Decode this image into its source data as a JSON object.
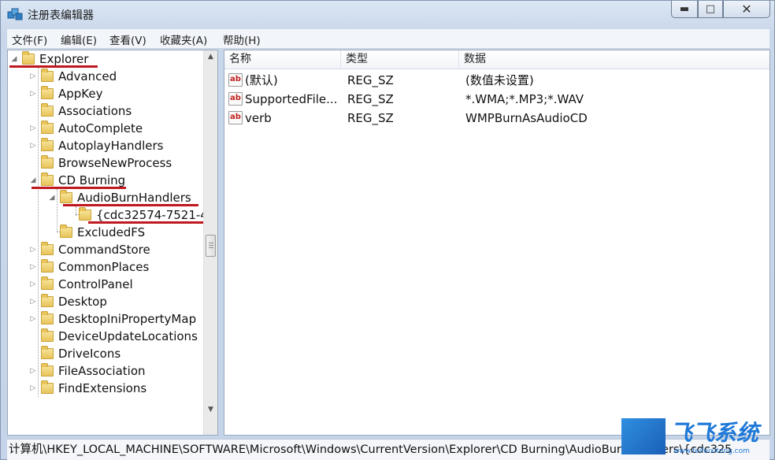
{
  "window": {
    "title": "注册表编辑器"
  },
  "menubar": {
    "items": [
      "文件(F)",
      "编辑(E)",
      "查看(V)",
      "收藏夹(A)",
      "帮助(H)"
    ]
  },
  "tree": {
    "items": [
      {
        "label": "Explorer",
        "level": 0,
        "expander": "open",
        "highlight": true
      },
      {
        "label": "Advanced",
        "level": 1,
        "expander": "closed"
      },
      {
        "label": "AppKey",
        "level": 1,
        "expander": "closed"
      },
      {
        "label": "Associations",
        "level": 1,
        "expander": "none"
      },
      {
        "label": "AutoComplete",
        "level": 1,
        "expander": "closed"
      },
      {
        "label": "AutoplayHandlers",
        "level": 1,
        "expander": "closed"
      },
      {
        "label": "BrowseNewProcess",
        "level": 1,
        "expander": "none"
      },
      {
        "label": "CD Burning",
        "level": 1,
        "expander": "open",
        "highlight": true
      },
      {
        "label": "AudioBurnHandlers",
        "level": 2,
        "expander": "open",
        "highlight": true
      },
      {
        "label": "{cdc32574-7521-4",
        "level": 3,
        "expander": "none",
        "highlight": true
      },
      {
        "label": "ExcludedFS",
        "level": 2,
        "expander": "none"
      },
      {
        "label": "CommandStore",
        "level": 1,
        "expander": "closed"
      },
      {
        "label": "CommonPlaces",
        "level": 1,
        "expander": "closed"
      },
      {
        "label": "ControlPanel",
        "level": 1,
        "expander": "closed"
      },
      {
        "label": "Desktop",
        "level": 1,
        "expander": "closed"
      },
      {
        "label": "DesktopIniPropertyMap",
        "level": 1,
        "expander": "closed"
      },
      {
        "label": "DeviceUpdateLocations",
        "level": 1,
        "expander": "none"
      },
      {
        "label": "DriveIcons",
        "level": 1,
        "expander": "none"
      },
      {
        "label": "FileAssociation",
        "level": 1,
        "expander": "closed"
      },
      {
        "label": "FindExtensions",
        "level": 1,
        "expander": "closed"
      }
    ]
  },
  "list": {
    "columns": [
      "名称",
      "类型",
      "数据"
    ],
    "rows": [
      {
        "name": "(默认)",
        "type": "REG_SZ",
        "data": "(数值未设置)"
      },
      {
        "name": "SupportedFile...",
        "type": "REG_SZ",
        "data": "*.WMA;*.MP3;*.WAV"
      },
      {
        "name": "verb",
        "type": "REG_SZ",
        "data": "WMPBurnAsAudioCD"
      }
    ],
    "value_icon": "ab"
  },
  "statusbar": {
    "path": "计算机\\HKEY_LOCAL_MACHINE\\SOFTWARE\\Microsoft\\Windows\\CurrentVersion\\Explorer\\CD Burning\\AudioBurnHandlers\\{cdc325"
  },
  "watermark": {
    "brand": "飞飞系统",
    "url": "www.feifeixitong.com"
  },
  "colors": {
    "highlight_underline": "#c0181f",
    "title_bg": "#cfdcec",
    "watermark": "#1e78d8"
  }
}
